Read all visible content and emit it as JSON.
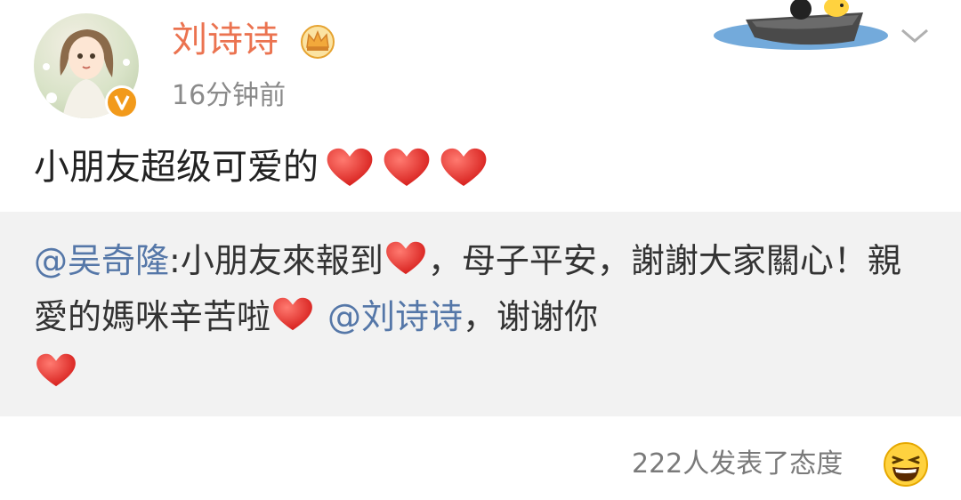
{
  "post": {
    "username": "刘诗诗",
    "time": "16分钟前",
    "text": "小朋友超级可爱的"
  },
  "repost": {
    "mention1": "@吴奇隆",
    "part1": ":小朋友來報到",
    "part2": "，母子平安，謝謝大家關心！親愛的媽咪辛苦啦",
    "mention2": "@刘诗诗",
    "part3": "，谢谢你"
  },
  "footer": {
    "reactions": "222人发表了态度"
  },
  "colors": {
    "username": "#eb7350",
    "mention": "#5577a8",
    "heart": "#e8302e",
    "vip_badge": "#f29a1b"
  },
  "icons": [
    "vip-crown-icon",
    "verified-v-icon",
    "chevron-down-icon",
    "heart-icon",
    "laughing-face-icon"
  ]
}
